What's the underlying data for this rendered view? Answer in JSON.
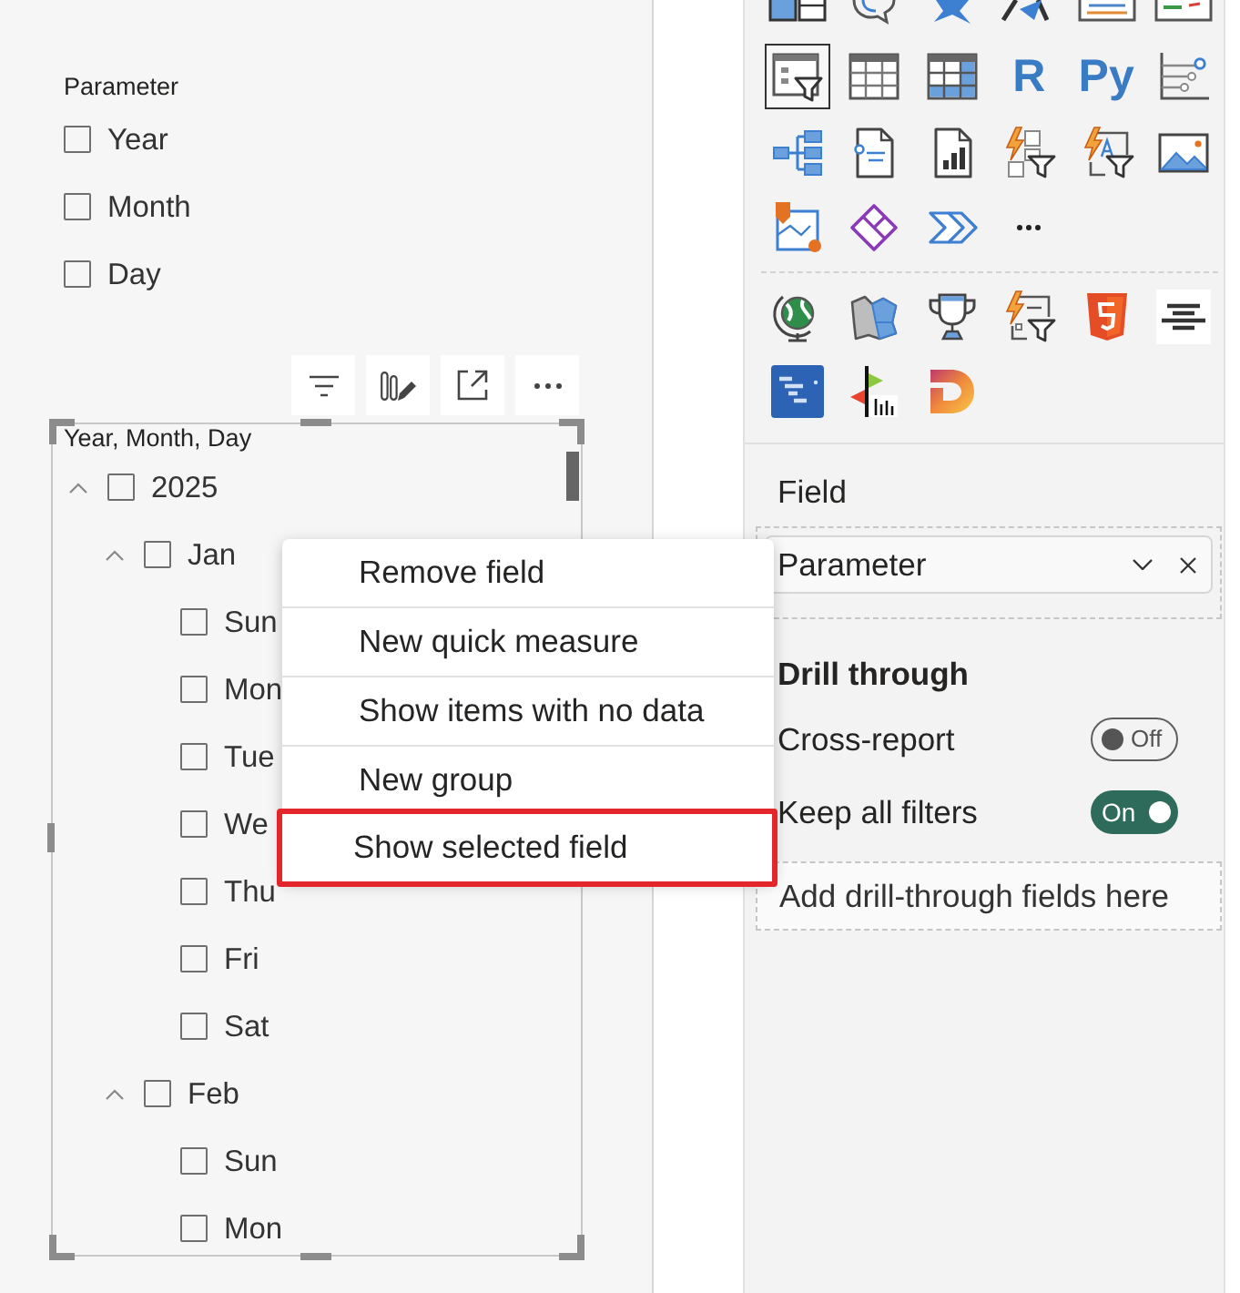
{
  "parameter_slicer": {
    "title": "Parameter",
    "items": [
      {
        "label": "Year",
        "checked": false
      },
      {
        "label": "Month",
        "checked": false
      },
      {
        "label": "Day",
        "checked": false
      }
    ]
  },
  "hierarchy_slicer": {
    "title": "Year, Month, Day",
    "tree": [
      {
        "label": "2025",
        "checked": false,
        "expanded": true,
        "children": [
          {
            "label": "Jan",
            "checked": false,
            "expanded": true,
            "children": [
              {
                "label": "Sun",
                "checked": false
              },
              {
                "label": "Mon",
                "checked": false
              },
              {
                "label": "Tue",
                "checked": false
              },
              {
                "label": "We",
                "checked": false
              },
              {
                "label": "Thu",
                "checked": false
              },
              {
                "label": "Fri",
                "checked": false
              },
              {
                "label": "Sat",
                "checked": false
              }
            ]
          },
          {
            "label": "Feb",
            "checked": false,
            "expanded": true,
            "children": [
              {
                "label": "Sun",
                "checked": false
              },
              {
                "label": "Mon",
                "checked": false
              }
            ]
          }
        ]
      }
    ]
  },
  "context_menu": {
    "items": [
      {
        "label": "Remove field",
        "highlighted": false
      },
      {
        "label": "New quick measure",
        "highlighted": false
      },
      {
        "label": "Show items with no data",
        "highlighted": false
      },
      {
        "label": "New group",
        "highlighted": false
      },
      {
        "label": "Show selected field",
        "highlighted": true
      }
    ]
  },
  "visualizations": {
    "slicer_selected": true,
    "r_label": "R",
    "python_label": "Py"
  },
  "field_well": {
    "heading": "Field",
    "value": "Parameter"
  },
  "drill_through": {
    "heading": "Drill through",
    "toggles": [
      {
        "label": "Cross-report",
        "on": false,
        "state_text": "Off"
      },
      {
        "label": "Keep all filters",
        "on": true,
        "state_text": "On"
      }
    ],
    "drop_zone": {
      "placeholder": "Add drill-through fields here"
    }
  }
}
